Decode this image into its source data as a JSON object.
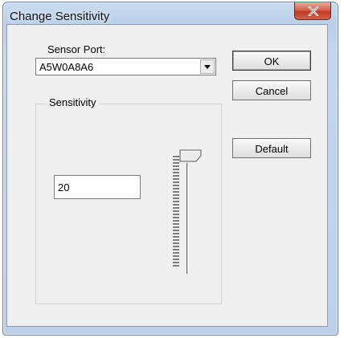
{
  "window": {
    "title": "Change Sensitivity",
    "close_icon": "close-icon"
  },
  "sensor_port": {
    "label": "Sensor Port:",
    "selected": "A5W0A8A6"
  },
  "buttons": {
    "ok": "OK",
    "cancel": "Cancel",
    "default": "Default"
  },
  "sensitivity": {
    "group_label": "Sensitivity",
    "value": "20",
    "slider_level_fraction": 0.95
  },
  "colors": {
    "close_button": "#c13a22",
    "frame": "#b9cfe7",
    "client": "#f0f0f0"
  }
}
